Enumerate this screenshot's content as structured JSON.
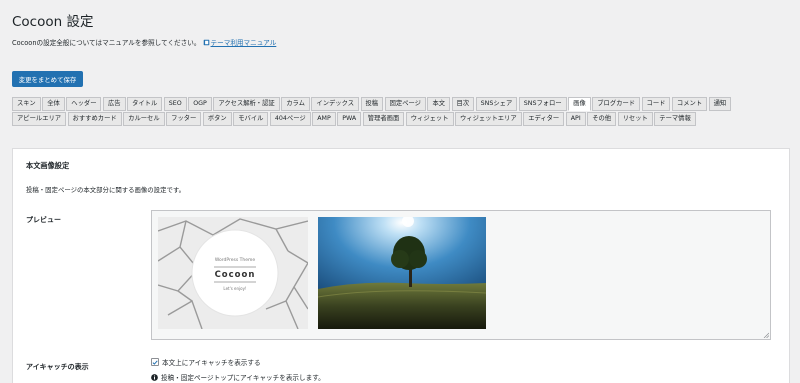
{
  "page": {
    "title": "Cocoon 設定",
    "intro_text": "Cocoonの設定全般についてはマニュアルを参照してください。",
    "manual_link": "テーマ利用マニュアル",
    "save_label": "変更をまとめて保存"
  },
  "tabs": [
    {
      "label": "スキン"
    },
    {
      "label": "全体"
    },
    {
      "label": "ヘッダー"
    },
    {
      "label": "広告"
    },
    {
      "label": "タイトル"
    },
    {
      "label": "SEO"
    },
    {
      "label": "OGP"
    },
    {
      "label": "アクセス解析・認証"
    },
    {
      "label": "カラム"
    },
    {
      "label": "インデックス"
    },
    {
      "label": "投稿"
    },
    {
      "label": "固定ページ"
    },
    {
      "label": "本文"
    },
    {
      "label": "目次"
    },
    {
      "label": "SNSシェア"
    },
    {
      "label": "SNSフォロー"
    },
    {
      "label": "画像"
    },
    {
      "label": "ブログカード"
    },
    {
      "label": "コード"
    },
    {
      "label": "コメント"
    },
    {
      "label": "通知"
    },
    {
      "label": "アピールエリア"
    },
    {
      "label": "おすすめカード"
    },
    {
      "label": "カルーセル"
    },
    {
      "label": "フッター"
    },
    {
      "label": "ボタン"
    },
    {
      "label": "モバイル"
    },
    {
      "label": "404ページ"
    },
    {
      "label": "AMP"
    },
    {
      "label": "PWA"
    },
    {
      "label": "管理者画面"
    },
    {
      "label": "ウィジェット"
    },
    {
      "label": "ウィジェットエリア"
    },
    {
      "label": "エディター"
    },
    {
      "label": "API"
    },
    {
      "label": "その他"
    },
    {
      "label": "リセット"
    },
    {
      "label": "テーマ情報"
    }
  ],
  "active_tab": "画像",
  "section": {
    "title": "本文画像設定",
    "description": "投稿・固定ページの本文部分に関する画像の設定です。",
    "preview_label": "プレビュー",
    "preview_images": [
      {
        "name": "cocoon-eyecatch",
        "tagline": "WordPress Theme",
        "brand": "Cocoon",
        "subline": "Let's enjoy!"
      },
      {
        "name": "tree-landscape"
      }
    ],
    "eyecatch_label": "アイキャッチの表示",
    "eyecatch_checkbox_label": "本文上にアイキャッチを表示する",
    "eyecatch_checked": true,
    "eyecatch_hint": "投稿・固定ページトップにアイキャッチを表示します。"
  },
  "colors": {
    "background": "#f0f0f1",
    "primary": "#2271b1",
    "panel": "#ffffff",
    "border": "#c3c4c7"
  }
}
